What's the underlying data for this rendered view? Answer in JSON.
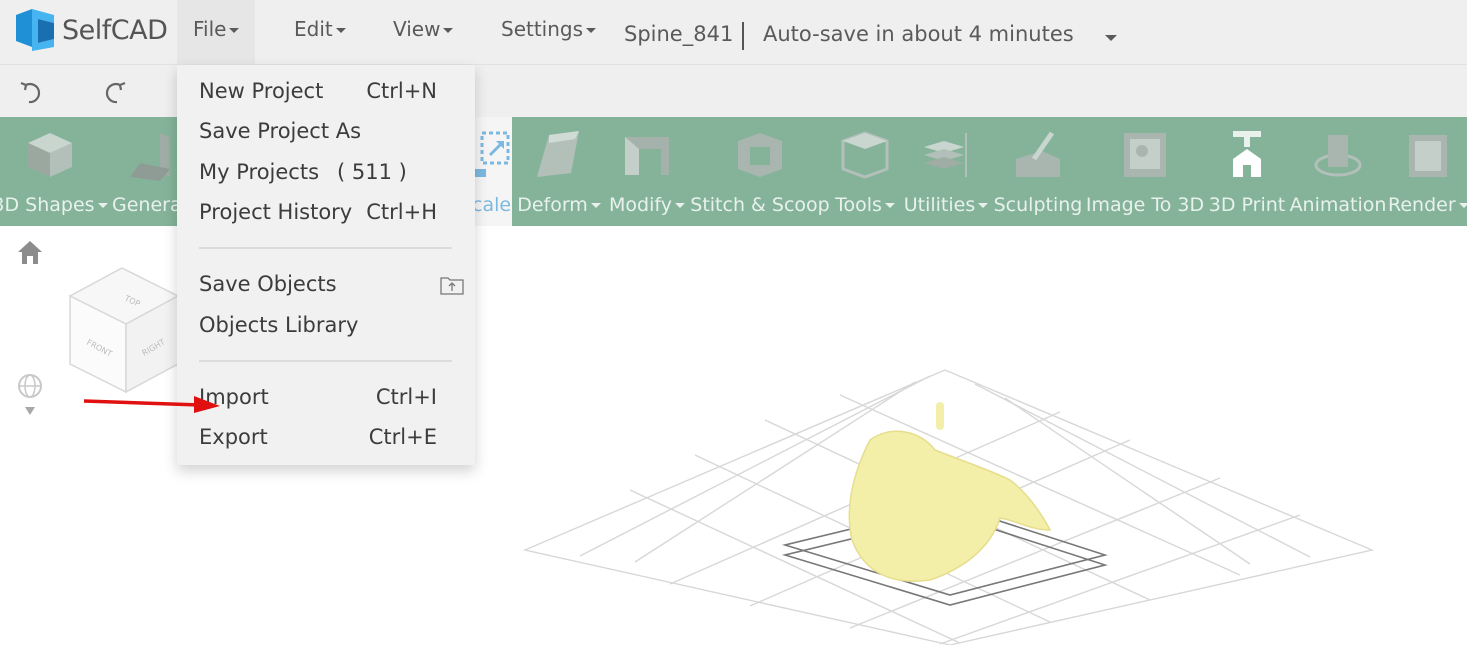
{
  "app": {
    "name": "SelfCAD",
    "project_name": "Spine_841",
    "autosave_text": "Auto-save in about 4 minutes"
  },
  "menubar": {
    "items": [
      {
        "label": "File"
      },
      {
        "label": "Edit"
      },
      {
        "label": "View"
      },
      {
        "label": "Settings"
      }
    ]
  },
  "toolbar": {
    "undo_icon": "undo-icon",
    "redo_icon": "redo-icon"
  },
  "ribbon": {
    "tools": [
      {
        "label": "3D Shapes",
        "dropdown": true
      },
      {
        "label": "Genera",
        "dropdown": false
      },
      {
        "label": "cale",
        "dropdown": false
      },
      {
        "label": "Deform",
        "dropdown": true
      },
      {
        "label": "Modify",
        "dropdown": true
      },
      {
        "label": "Stitch & Scoop",
        "dropdown": false
      },
      {
        "label": "Tools",
        "dropdown": true
      },
      {
        "label": "Utilities",
        "dropdown": true
      },
      {
        "label": "Sculpting",
        "dropdown": false
      },
      {
        "label": "Image To 3D",
        "dropdown": false
      },
      {
        "label": "3D Print",
        "dropdown": false
      },
      {
        "label": "Animation",
        "dropdown": false
      },
      {
        "label": "Render",
        "dropdown": true
      }
    ]
  },
  "viewcube": {
    "top": "TOP",
    "front": "FRONT",
    "right": "RIGHT"
  },
  "file_menu": {
    "items": [
      {
        "label": "New Project",
        "shortcut": "Ctrl+N"
      },
      {
        "label": "Save Project As",
        "shortcut": ""
      },
      {
        "label": "My Projects",
        "count": "( 511 )"
      },
      {
        "label": "Project History",
        "shortcut": "Ctrl+H"
      },
      {
        "label": "Save Objects",
        "icon": "folder-upload-icon"
      },
      {
        "label": "Objects Library",
        "shortcut": ""
      },
      {
        "label": "Import",
        "shortcut": "Ctrl+I"
      },
      {
        "label": "Export",
        "shortcut": "Ctrl+E"
      }
    ]
  },
  "colors": {
    "ribbon": "#84b39a",
    "menubar": "#efefef",
    "model": "#f3efa8",
    "annotation_arrow": "#e01010"
  }
}
